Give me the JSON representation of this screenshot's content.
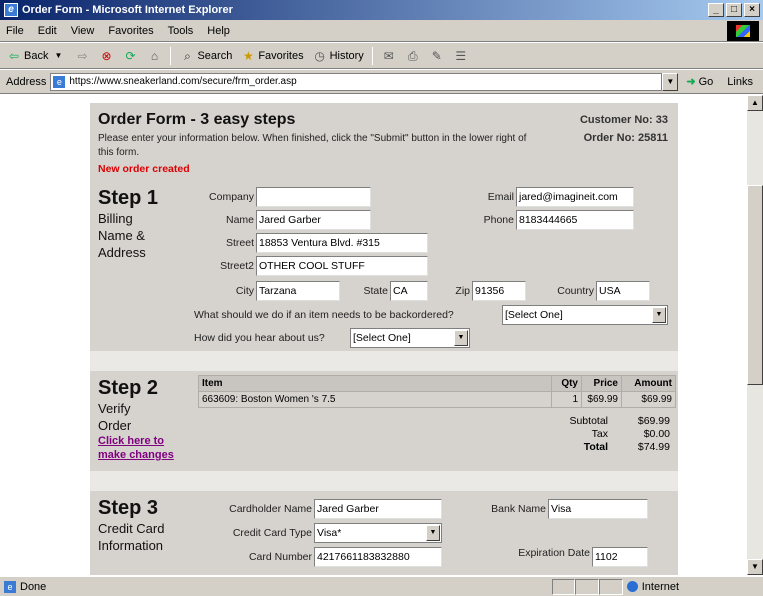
{
  "window": {
    "title": "Order Form - Microsoft Internet Explorer",
    "min": "_",
    "max": "□",
    "close": "×"
  },
  "menu": [
    "File",
    "Edit",
    "View",
    "Favorites",
    "Tools",
    "Help"
  ],
  "toolbar": {
    "back": "Back",
    "search": "Search",
    "favorites": "Favorites",
    "history": "History"
  },
  "address": {
    "label": "Address",
    "url": "https://www.sneakerland.com/secure/frm_order.asp",
    "go": "Go",
    "links": "Links"
  },
  "status": {
    "text": "Done",
    "zone": "Internet"
  },
  "form": {
    "title": "Order Form - 3 easy steps",
    "instructions": "Please enter your information below.  When finished, click the \"Submit\" button in the lower right of this form.",
    "status_msg": "New order created",
    "customer_no": "Customer No: 33",
    "order_no": "Order No: 25811"
  },
  "step1": {
    "title": "Step 1",
    "subtitle_1": "Billing",
    "subtitle_2": "Name &",
    "subtitle_3": "Address",
    "company_label": "Company",
    "company": "",
    "name_label": "Name",
    "name": "Jared Garber",
    "street_label": "Street",
    "street": "18853 Ventura Blvd. #315",
    "street2_label": "Street2",
    "street2": "OTHER COOL STUFF",
    "city_label": "City",
    "city": "Tarzana",
    "state_label": "State",
    "state": "CA",
    "zip_label": "Zip",
    "zip": "91356",
    "country_label": "Country",
    "country": "USA",
    "email_label": "Email",
    "email": "jared@imagineit.com",
    "phone_label": "Phone",
    "phone": "8183444665",
    "backorder_label": "What should we do if an  item needs to be backordered?",
    "backorder": "[Select One]",
    "hear_label": "How did you hear about us?",
    "hear": "[Select One]"
  },
  "step2": {
    "title": "Step 2",
    "subtitle_1": "Verify",
    "subtitle_2": "Order",
    "link_1": "Click here to",
    "link_2": "make changes",
    "columns": {
      "item": "Item",
      "qty": "Qty",
      "price": "Price",
      "amount": "Amount"
    },
    "rows": [
      {
        "item": "663609: Boston Women 's 7.5",
        "qty": "1",
        "price": "$69.99",
        "amount": "$69.99"
      }
    ],
    "subtotal_label": "Subtotal",
    "subtotal": "$69.99",
    "tax_label": "Tax",
    "tax": "$0.00",
    "total_label": "Total",
    "total": "$74.99"
  },
  "step3": {
    "title": "Step 3",
    "subtitle_1": "Credit Card",
    "subtitle_2": "Information",
    "holder_label": "Cardholder Name",
    "holder": "Jared Garber",
    "type_label": "Credit Card Type",
    "type": "Visa*",
    "number_label": "Card Number",
    "number": "4217661183832880",
    "bank_label": "Bank Name",
    "bank": "Visa",
    "exp_label": "Expiration Date",
    "exp": "1102"
  }
}
